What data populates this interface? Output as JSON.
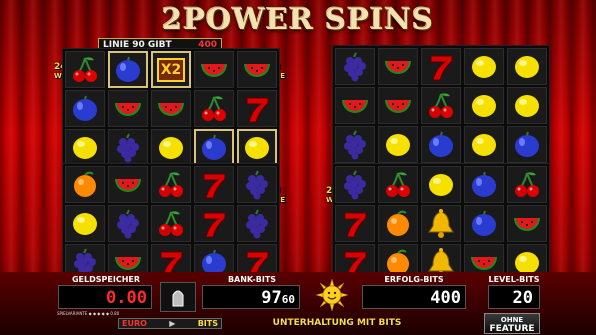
{
  "title": "2POWER SPINS",
  "banner": {
    "label": "LINIE 90 GIBT",
    "value": "400"
  },
  "multiplier": "X2",
  "ways": {
    "number": "243",
    "word": "WEGE"
  },
  "panels": [
    {
      "grid": [
        [
          "cherry",
          "plum",
          "bar-x2",
          "melon",
          "melon"
        ],
        [
          "plum",
          "melon",
          "melon",
          "cherry",
          "seven"
        ],
        [
          "lemon",
          "grapes",
          "lemon",
          "plum",
          "lemon"
        ]
      ],
      "highlight": [
        [
          0,
          1
        ],
        [
          0,
          2
        ],
        [
          2,
          3
        ],
        [
          2,
          4
        ]
      ]
    },
    {
      "grid": [
        [
          "grapes",
          "melon",
          "seven",
          "lemon",
          "lemon"
        ],
        [
          "melon",
          "melon",
          "cherry",
          "lemon",
          "lemon"
        ],
        [
          "grapes",
          "lemon",
          "plum",
          "lemon",
          "plum"
        ]
      ],
      "highlight": []
    },
    {
      "grid": [
        [
          "orange",
          "melon",
          "cherry",
          "seven",
          "grapes"
        ],
        [
          "lemon",
          "grapes",
          "cherry",
          "seven",
          "grapes"
        ],
        [
          "grapes",
          "melon",
          "seven",
          "plum",
          "seven"
        ]
      ],
      "highlight": []
    },
    {
      "grid": [
        [
          "grapes",
          "cherry",
          "lemon",
          "plum",
          "cherry"
        ],
        [
          "seven",
          "orange",
          "bell",
          "plum",
          "melon"
        ],
        [
          "seven",
          "orange",
          "bell",
          "melon",
          "lemon"
        ]
      ],
      "highlight": []
    }
  ],
  "bottom": {
    "geldspeicher_label": "GELDSPEICHER (EURO)",
    "geldspeicher_value": "0.00",
    "bank_label": "BANK-BITS",
    "bank_value_main": "97",
    "bank_value_small": "60",
    "erfolg_label": "ERFOLG-BITS",
    "erfolg_value": "400",
    "level_label": "LEVEL-BITS",
    "level_value": "20",
    "spielvariante": "SPIELVARIANTE ◆ ◆ ◆ ◆ ◆ 0.80",
    "euro_label": "EURO",
    "bits_label": "BITS",
    "unterhaltung": "UNTERHALTUNG MIT BITS",
    "ohne_line1": "OHNE",
    "ohne_line2": "FEATURE"
  },
  "colors": {
    "accent_red": "#ff2a2a",
    "gold": "#ffd84a",
    "curtain": "#c80000"
  }
}
